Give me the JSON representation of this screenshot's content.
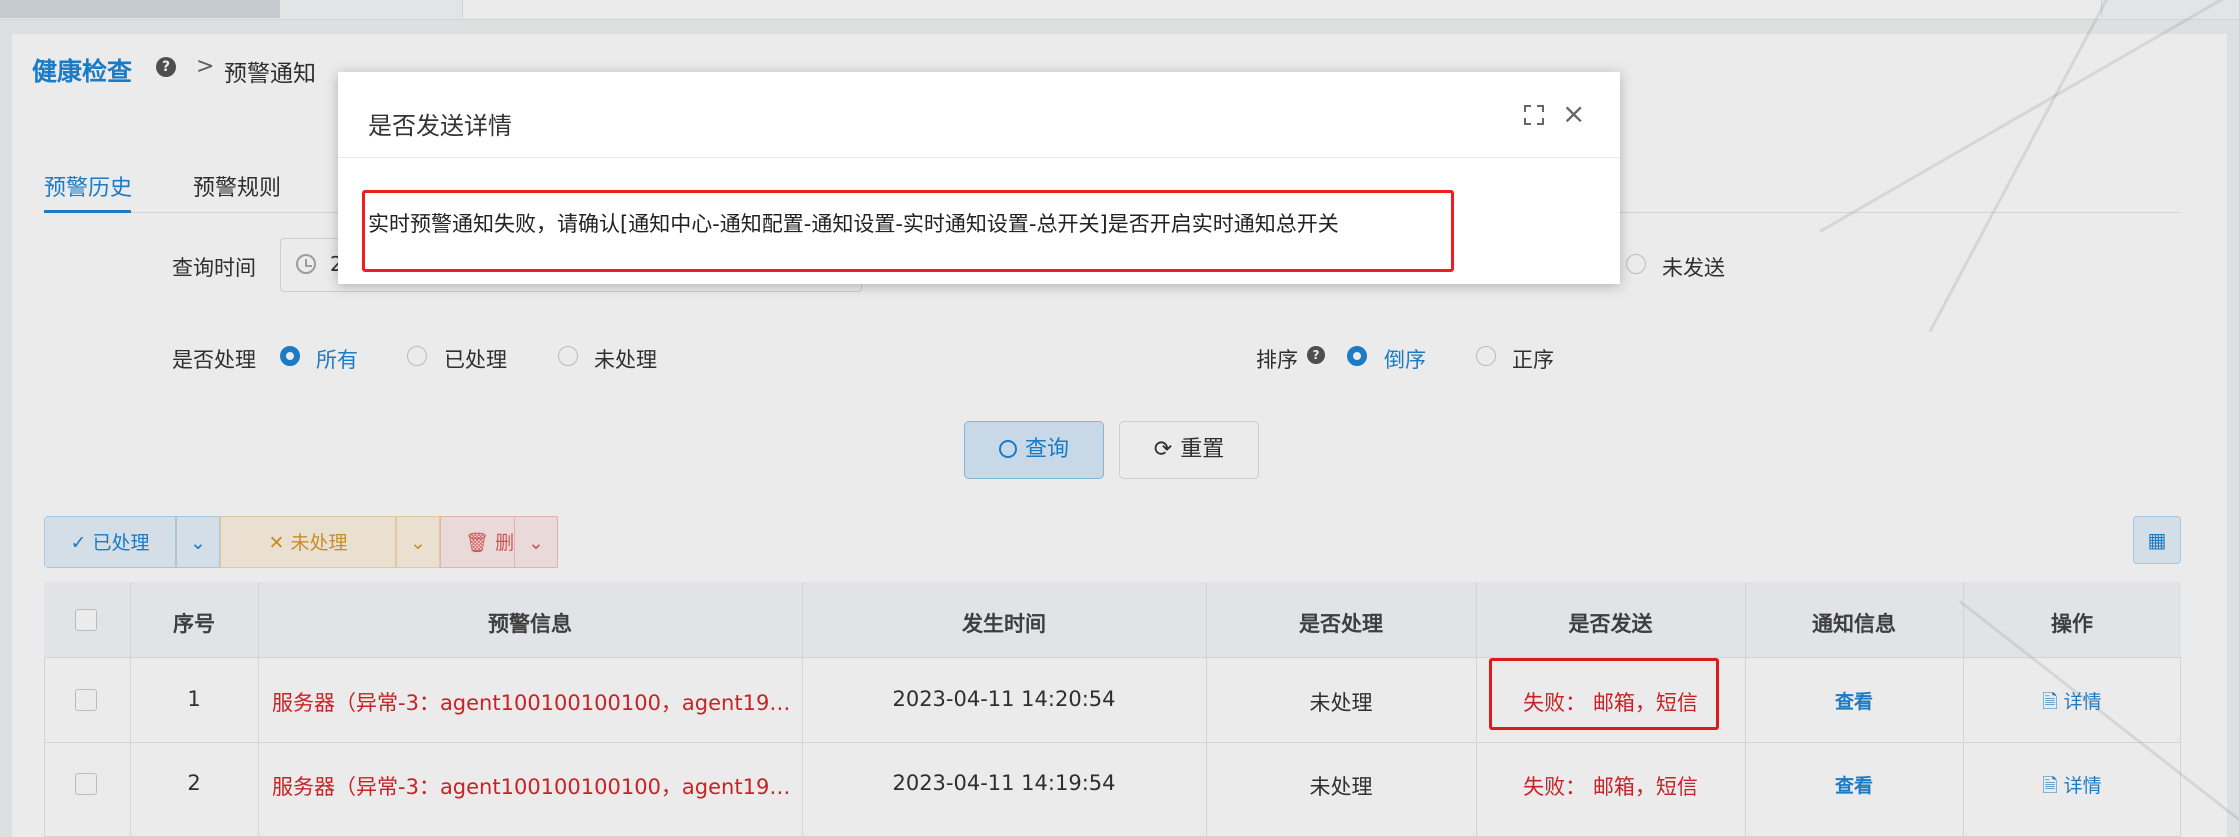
{
  "breadcrumb": {
    "root": "健康检查",
    "help": "?",
    "sep": ">",
    "current": "预警通知"
  },
  "tabs": [
    {
      "label": "预警历史",
      "active": true
    },
    {
      "label": "预警规则",
      "active": false
    }
  ],
  "filters": {
    "query_time_label": "查询时间",
    "date_value": "2",
    "sent_partial_label": "未发送",
    "handled_label": "是否处理",
    "handled_options": [
      {
        "label": "所有",
        "checked": true
      },
      {
        "label": "已处理",
        "checked": false
      },
      {
        "label": "未处理",
        "checked": false
      }
    ],
    "sort_label": "排序",
    "sort_help": "?",
    "sort_options": [
      {
        "label": "倒序",
        "checked": true
      },
      {
        "label": "正序",
        "checked": false
      }
    ]
  },
  "buttons": {
    "query": "查询",
    "reset": "重置"
  },
  "actions": {
    "mark_done": "已处理",
    "mark_undone": "未处理",
    "delete": "删除"
  },
  "table": {
    "headers": [
      "序号",
      "预警信息",
      "发生时间",
      "是否处理",
      "是否发送",
      "通知信息",
      "操作"
    ],
    "rows": [
      {
        "index": "1",
        "message": "服务器（异常-3：agent100100100100，agent19…",
        "time": "2023-04-11 14:20:54",
        "handled": "未处理",
        "sent": "失败：  邮箱，短信",
        "notify": "查看",
        "op": "详情"
      },
      {
        "index": "2",
        "message": "服务器（异常-3：agent100100100100，agent19…",
        "time": "2023-04-11 14:19:54",
        "handled": "未处理",
        "sent": "失败：  邮箱，短信",
        "notify": "查看",
        "op": "详情"
      }
    ]
  },
  "modal": {
    "title": "是否发送详情",
    "body": "实时预警通知失败，请确认[通知中心-通知配置-通知设置-实时通知设置-总开关]是否开启实时通知总开关"
  },
  "colors": {
    "accent": "#1f86d6",
    "danger": "#d8262b",
    "annotation": "#f01e1e"
  }
}
